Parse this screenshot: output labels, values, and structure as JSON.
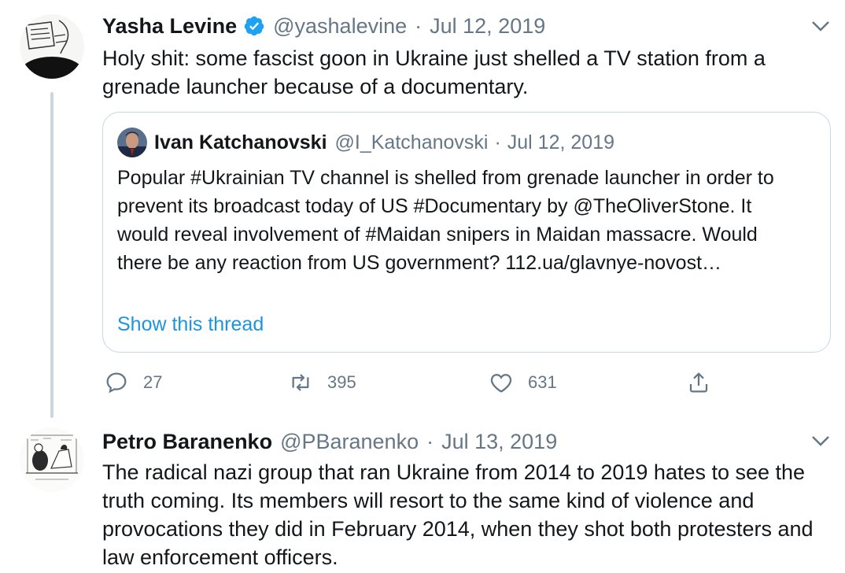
{
  "colors": {
    "link": "#1b95e0",
    "muted": "#657786",
    "text": "#14171a",
    "border": "#ccd6dd"
  },
  "tweet1": {
    "name": "Yasha Levine",
    "handle": "@yashalevine",
    "separator": "·",
    "date": "Jul 12, 2019",
    "text": "Holy shit: some fascist goon in Ukraine just shelled a TV station from a grenade launcher because  of a documentary.",
    "verified_icon": "verified-badge-icon",
    "menu_icon": "chevron-down-icon",
    "quote": {
      "name": "Ivan Katchanovski",
      "handle": "@I_Katchanovski",
      "separator": "·",
      "date": "Jul 12, 2019",
      "text": "Popular #Ukrainian TV channel is shelled from grenade launcher in order to prevent its broadcast today of US #Documentary by @TheOliverStone. It would reveal involvement of #Maidan snipers in Maidan massacre. Would there be any reaction from US government? 112.ua/glavnye-novost…",
      "show_thread": "Show this thread"
    },
    "actions": {
      "replies": "27",
      "retweets": "395",
      "likes": "631"
    }
  },
  "tweet2": {
    "name": "Petro Baranenko",
    "handle": "@PBaranenko",
    "separator": "·",
    "date": "Jul 13, 2019",
    "text": "The radical nazi group that ran Ukraine from 2014 to 2019 hates to see the truth coming. Its members will resort to the same kind of violence and provocations they did in February 2014, when they shot both protesters and law enforcement officers.",
    "menu_icon": "chevron-down-icon"
  }
}
